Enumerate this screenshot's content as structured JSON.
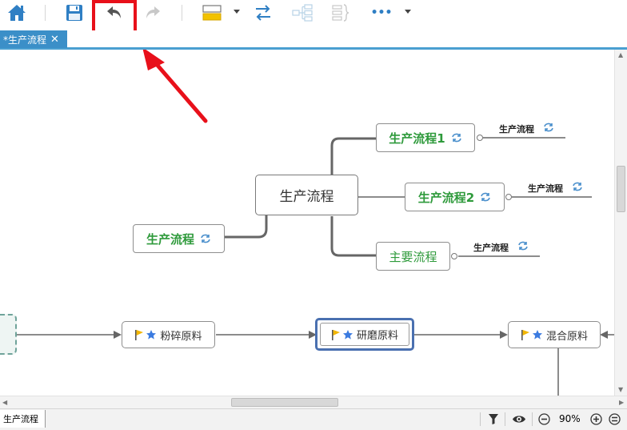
{
  "toolbar": {
    "icons": [
      "home-icon",
      "save-icon",
      "undo-icon",
      "redo-icon",
      "topic-style-icon",
      "relationship-icon",
      "structure-icon",
      "boundary-icon",
      "more-icon"
    ],
    "more_label": "•••"
  },
  "tab": {
    "title": "*生产流程",
    "close": "✕"
  },
  "map": {
    "center": "生产流程",
    "left_topic": "生产流程",
    "topics": [
      {
        "label": "生产流程1",
        "sub": "生产流程"
      },
      {
        "label": "生产流程2",
        "sub": "生产流程"
      },
      {
        "label": "主要流程",
        "sub": "生产流程"
      }
    ]
  },
  "flow": {
    "steps": [
      "粉碎原料",
      "研磨原料",
      "混合原料"
    ]
  },
  "status": {
    "sheet": "生产流程",
    "zoom": "90%"
  },
  "colors": {
    "accent": "#3b8fc8",
    "topic_green": "#2e9a3b",
    "annotation_red": "#e8101a",
    "flag_yellow": "#f2b600",
    "star_blue": "#3b7be0"
  }
}
